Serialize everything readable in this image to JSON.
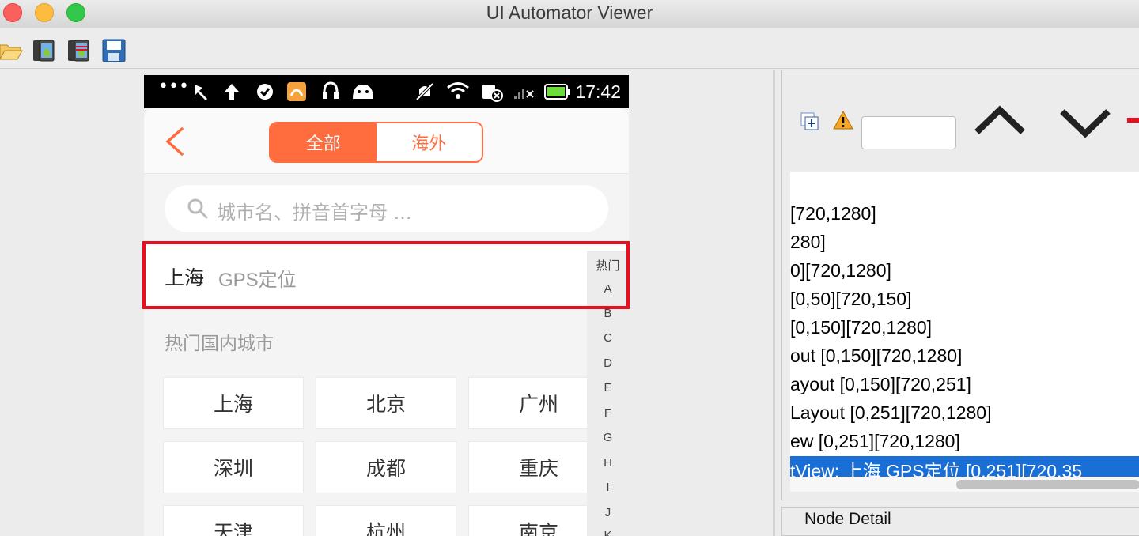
{
  "window": {
    "title": "UI Automator Viewer"
  },
  "toolbar": {
    "icons": [
      "open-folder-icon",
      "device-screenshot-icon",
      "device-screenshot-compressed-icon",
      "save-icon"
    ]
  },
  "phone": {
    "statusbar": {
      "time": "17:42",
      "icons": [
        "more-icon",
        "pin-icon",
        "upload-icon",
        "check-icon",
        "app-icon",
        "headset-icon",
        "android-icon",
        "mute-icon",
        "wifi-icon",
        "sim-icon",
        "signal-icon",
        "battery-icon"
      ]
    },
    "header": {
      "tab_all": "全部",
      "tab_overseas": "海外",
      "accent": "#ff6d3f"
    },
    "search": {
      "placeholder": "城市名、拼音首字母 ..."
    },
    "gps": {
      "city": "上海",
      "label": "GPS定位"
    },
    "hot_title": "热门国内城市",
    "hot_cities": [
      "上海",
      "北京",
      "广州",
      "深圳",
      "成都",
      "重庆",
      "天津",
      "杭州",
      "南京"
    ],
    "index": [
      "热门",
      "A",
      "B",
      "C",
      "D",
      "E",
      "F",
      "G",
      "H",
      "I",
      "J",
      "K"
    ]
  },
  "right_panel": {
    "highlight_color": "#e8101e",
    "tree_lines": [
      "[720,1280]",
      "280]",
      "0][720,1280]",
      "[0,50][720,150]",
      "[0,150][720,1280]",
      "out [0,150][720,1280]",
      "ayout [0,150][720,251]",
      "Layout [0,251][720,1280]",
      "ew [0,251][720,1280]"
    ],
    "tree_selected": "tView: 上海  GPS定位 [0,251][720,35",
    "node_detail_title": "Node Detail"
  }
}
